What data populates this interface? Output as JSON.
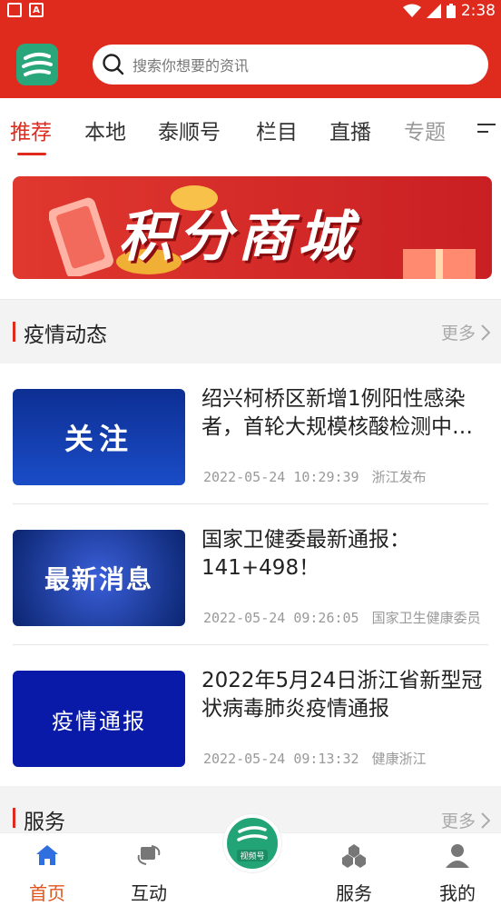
{
  "status_bar": {
    "time": "2:38"
  },
  "header": {
    "search_placeholder": "搜索你想要的资讯"
  },
  "tabs": [
    {
      "label": "推荐",
      "active": true
    },
    {
      "label": "本地"
    },
    {
      "label": "泰顺号"
    },
    {
      "label": "栏目"
    },
    {
      "label": "直播"
    },
    {
      "label": "专题"
    }
  ],
  "banner": {
    "text": "积分商城"
  },
  "section_epidemic": {
    "title": "疫情动态",
    "more": "更多"
  },
  "news": [
    {
      "thumb_text": "关注",
      "headline": "绍兴柯桥区新增1例阳性感染者，首轮大规模核酸检测中…",
      "date": "2022-05-24 10:29:39",
      "source": "浙江发布"
    },
    {
      "thumb_text": "最新消息",
      "headline": "国家卫健委最新通报：141+498！",
      "date": "2022-05-24 09:26:05",
      "source": "国家卫生健康委员"
    },
    {
      "thumb_text": "疫情通报",
      "headline": "2022年5月24日浙江省新型冠状病毒肺炎疫情通报",
      "date": "2022-05-24 09:13:32",
      "source": "健康浙江"
    }
  ],
  "section_service": {
    "title": "服务",
    "more": "更多"
  },
  "bottom_nav": [
    {
      "label": "首页",
      "icon": "home-icon",
      "active": true
    },
    {
      "label": "互动",
      "icon": "interact-icon"
    },
    {
      "label": "视频号",
      "icon": "video-icon"
    },
    {
      "label": "服务",
      "icon": "service-icon"
    },
    {
      "label": "我的",
      "icon": "profile-icon"
    }
  ],
  "colors": {
    "brand_red": "#de2b1d",
    "brand_green": "#22a477",
    "active_orange": "#e2541b"
  }
}
